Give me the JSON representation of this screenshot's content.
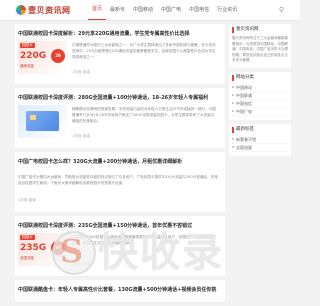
{
  "header": {
    "logo_text": "壹贝资讯网",
    "nav": [
      "首页",
      "最新专",
      "中国移动",
      "中国广电",
      "中国电信",
      "行业资讯"
    ],
    "active_index": 0
  },
  "articles": [
    {
      "title": "中国联通校园卡深度解析：29元享220G通用流量，学生党专属高性价比选择",
      "summary": "中国联通作为国内三大运营商之一，为广大学生群体推出了多款专属校园卡套餐。在众多的选择中，29元月租享受220G通用流量的套餐备受关注，这款校园卡以超高性价比成为学生党的首选之一。",
      "meta": "1天前  阅读",
      "thumb": {
        "type": "red",
        "badge": "校园卡",
        "big": "220G",
        "small": "通用流量",
        "tag": "29"
      }
    },
    {
      "title": "中国联通校园卡深度评测：280G全国流量+100分钟通话，18-26岁年轻人专属福利",
      "summary": "随着移动互联网的快速发展，手机流量已经成为年轻人日常生活中不可或缺的一部分。中国联通专门针对18-26岁年轻用户推出了280G全国流量校园卡，为学生群体带来了大流量与通话的完美组合。",
      "meta": "1天前  阅读",
      "thumb": {
        "type": "blue"
      }
    },
    {
      "title": "中国广电校园卡怎么样？320G大流量+200分钟通话，月租优惠详细解析",
      "summary": "中国广电作为第四大运营商，凭借其大流量低月租的特点吸引了众多用户。广电校园卡提供320G大流量与200分钟通话，非常适合校园学生使用，下面为大家详细解析这款校园卡的资费与优惠。",
      "meta": "1天前  阅读",
      "thumb": null
    },
    {
      "title": "中国联通校园卡深度评测：235G全国流量+150分钟通话，首年优惠不容错过",
      "summary": "中国联通235G校园卡以首年优惠的超值资费吸引了大量学生用户，全国通用流量加通话分钟数，满足学生日常上网与通讯需求。",
      "meta": "1天前  阅读",
      "thumb": {
        "type": "red",
        "badge": "校园卡",
        "big": "235G",
        "small": "全国流量",
        "tag": "19"
      }
    },
    {
      "title": "中国联通酷盘卡：年轻人专属高性价比套餐，130G流量+500分钟通话+视频会员任你挑",
      "summary": "",
      "meta": "",
      "thumb": null
    }
  ],
  "sidebar": {
    "about": {
      "title": "壹贝资讯网",
      "text": "壹贝资讯网专注于三大运营商最新套餐资讯，为您提供中国移动、中国联通、中国电信、中国广电手机卡办理攻略，帮您找到适合自己的高性价比手机卡套餐。"
    },
    "categories": {
      "title": "网站分类",
      "items": [
        "中国移动",
        "中国联通",
        "中国电信",
        "中国广电"
      ]
    },
    "recent": {
      "title": "最新标签",
      "items": [
        "新套餐不错",
        "全国流量"
      ]
    }
  },
  "watermark": {
    "logo_letter": "S",
    "text": "快收录"
  }
}
